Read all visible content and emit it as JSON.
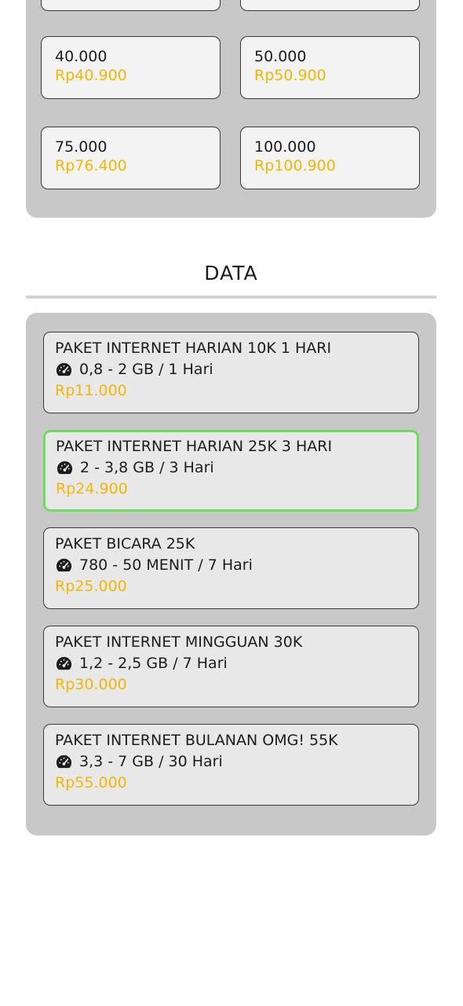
{
  "pulsa": {
    "cards": [
      {
        "nominal": "40.000",
        "price": "Rp40.900"
      },
      {
        "nominal": "50.000",
        "price": "Rp50.900"
      },
      {
        "nominal": "75.000",
        "price": "Rp76.400"
      },
      {
        "nominal": "100.000",
        "price": "Rp100.900"
      }
    ]
  },
  "data_section": {
    "title": "DATA",
    "packages": [
      {
        "name": "PAKET INTERNET HARIAN 10K 1 HARI",
        "icon": "speedometer-icon",
        "quota": "0,8 - 2 GB / 1 Hari",
        "price": "Rp11.000",
        "selected": false
      },
      {
        "name": "PAKET INTERNET HARIAN 25K 3 HARI",
        "icon": "speedometer-icon",
        "quota": "2 - 3,8 GB / 3 Hari",
        "price": "Rp24.900",
        "selected": true
      },
      {
        "name": "PAKET BICARA 25K",
        "icon": "speedometer-icon",
        "quota": "780 - 50 MENIT / 7 Hari",
        "price": "Rp25.000",
        "selected": false
      },
      {
        "name": "PAKET INTERNET MINGGUAN 30K",
        "icon": "speedometer-icon",
        "quota": "1,2 - 2,5 GB / 7 Hari",
        "price": "Rp30.000",
        "selected": false
      },
      {
        "name": "PAKET INTERNET BULANAN OMG! 55K",
        "icon": "speedometer-icon",
        "quota": "3,3 - 7 GB / 30 Hari",
        "price": "Rp55.000",
        "selected": false
      }
    ]
  },
  "colors": {
    "price": "#f2b705",
    "selected_border": "#6fdc5f",
    "panel": "#c8c8c8"
  }
}
